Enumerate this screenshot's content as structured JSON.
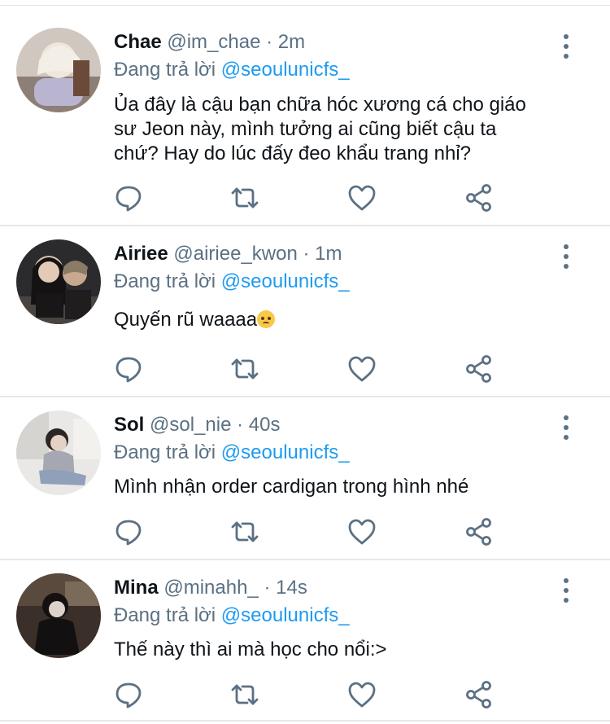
{
  "tweets": [
    {
      "name": "Chae",
      "handle": "@im_chae",
      "time": "2m",
      "replying_prefix": "Đang trả lời ",
      "replying_to": "@seoulunicfs_",
      "text_lines": [
        "Ủa đây là cậu bạn chữa hóc xương cá cho giáo",
        "sư Jeon này, mình tưởng ai cũng biết cậu ta",
        "chứ? Hay do lúc đấy đeo khẩu trang nhỉ?"
      ]
    },
    {
      "name": "Airiee",
      "handle": "@airiee_kwon",
      "time": "1m",
      "replying_prefix": "Đang trả lời ",
      "replying_to": "@seoulunicfs_",
      "text_lines": [
        "Quyến rũ waaaa"
      ],
      "emoji": "pleading-face-emoji"
    },
    {
      "name": "Sol",
      "handle": "@sol_nie",
      "time": "40s",
      "replying_prefix": "Đang trả lời ",
      "replying_to": "@seoulunicfs_",
      "text_lines": [
        "Mình nhận order cardigan trong hình nhé"
      ]
    },
    {
      "name": "Mina",
      "handle": "@minahh_",
      "time": "14s",
      "replying_prefix": "Đang trả lời ",
      "replying_to": "@seoulunicfs_",
      "text_lines": [
        "Thế này thì ai mà học cho nổi:>"
      ]
    }
  ],
  "separator": "·",
  "icons": {
    "reply": "reply-icon",
    "retweet": "retweet-icon",
    "like": "heart-icon",
    "share": "share-icon",
    "more": "more-vertical-icon"
  },
  "colors": {
    "text": "#0f1419",
    "secondary": "#5b7083",
    "mention": "#1d9bf0",
    "divider": "#e6e8ea"
  }
}
